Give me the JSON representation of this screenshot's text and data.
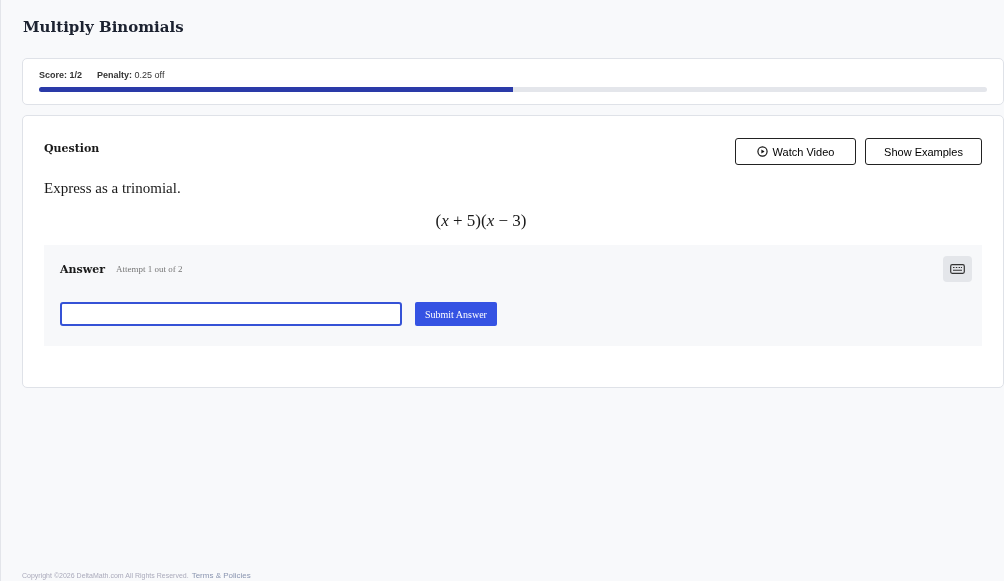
{
  "title": "Multiply Binomials",
  "score": {
    "label": "Score:",
    "value": "1/2",
    "penalty_label": "Penalty:",
    "penalty_value": "0.25 off",
    "level": 0.5
  },
  "question": {
    "heading": "Question",
    "buttons": [
      {
        "kind": "video",
        "label": "Watch Video"
      },
      {
        "kind": "plain",
        "label": "Show Examples"
      }
    ],
    "prompt": "Express as a trinomial.",
    "expression": "(*x* + 5)(*x* − 3)"
  },
  "answer": {
    "heading": "Answer",
    "attempt": "Attempt 1 out of 2",
    "submit": "Submit Answer"
  },
  "footer": {
    "copyright": "Copyright ©2026 DeltaMath.com All Rights Reserved.",
    "link": "Terms & Policies"
  }
}
